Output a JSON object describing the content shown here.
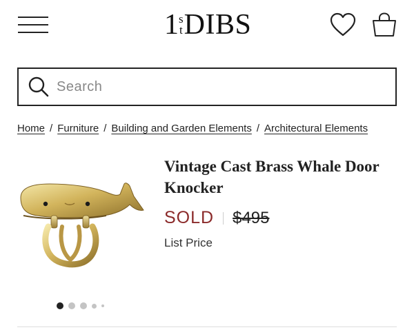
{
  "header": {
    "logo": {
      "one": "1",
      "st_s": "s",
      "st_t": "t",
      "dibs": "DIBS"
    },
    "menu_icon": "hamburger-menu-icon",
    "favorites_icon": "heart-icon",
    "cart_icon": "shopping-bag-icon"
  },
  "search": {
    "placeholder": "Search",
    "value": "",
    "icon": "search-icon"
  },
  "breadcrumb": {
    "items": [
      "Home",
      "Furniture",
      "Building and Garden Elements",
      "Architectural Elements"
    ],
    "separator": "/"
  },
  "product": {
    "title": "Vintage Cast Brass Whale Door Knocker",
    "status": "SOLD",
    "price": "$495",
    "price_note": "List Price",
    "image_icon": "brass-whale-door-knocker-image",
    "status_color": "#8b2a2a"
  },
  "carousel": {
    "count": 5,
    "active_index": 0
  }
}
